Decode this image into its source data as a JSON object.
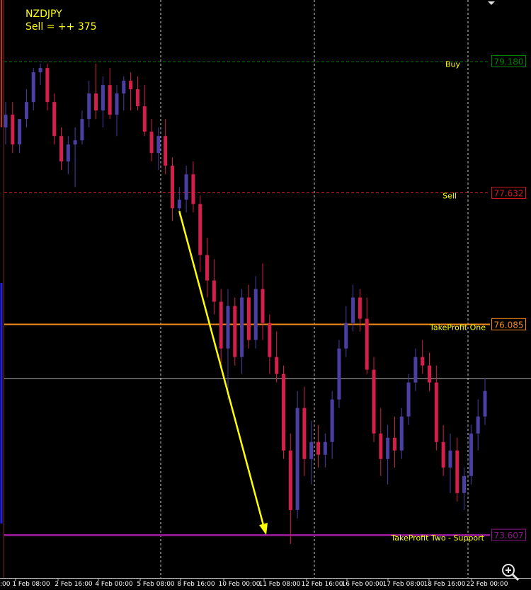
{
  "header": {
    "symbol": "NZDJPY",
    "signal": "Sell = ++ 375"
  },
  "colors": {
    "background": "#000000",
    "bull_candle": "#4c3fa3",
    "bear_candle": "#d41f4b",
    "grid": "#ffffff",
    "axis_label": "#ffffff",
    "buy_line": "#008000",
    "sell_line": "#cc1a1a",
    "tp1_line": "#f08a1c",
    "tp2_line": "#8a188a",
    "current_line": "#c8c8c8",
    "arrow": "#ffff00",
    "label_text": "#ffff00"
  },
  "chart_data": {
    "type": "candlestick",
    "symbol": "NZDJPY",
    "ylim": [
      73.1,
      79.9
    ],
    "x_axis_labels": [
      "1 Feb 08:00",
      "2 Feb 16:00",
      "4 Feb 00:00",
      "5 Feb 08:00",
      "8 Feb 16:00",
      "10 Feb 00:00",
      "11 Feb 08:00",
      "12 Feb 16:00",
      "16 Feb 00:00",
      "17 Feb 08:00",
      "18 Feb 16:00",
      "22 Feb 00:00"
    ],
    "x_axis_partial_label": ":00",
    "price_levels": [
      {
        "name": "Buy",
        "label": "Buy",
        "value": 79.18,
        "value_text": "79.180",
        "style": "dashed"
      },
      {
        "name": "Sell",
        "label": "Sell",
        "value": 77.632,
        "value_text": "77.632",
        "style": "dashed"
      },
      {
        "name": "TakeProfit One",
        "label": "TakeProfit One",
        "value": 76.085,
        "value_text": "76.085",
        "style": "solid"
      },
      {
        "name": "TakeProfit Two - Support",
        "label": "TakeProfit Two - Support",
        "value": 73.607,
        "value_text": "73.607",
        "style": "solid"
      }
    ],
    "current_price": 75.45,
    "candles": [
      [
        78.4,
        78.7,
        78.2,
        78.55
      ],
      [
        78.55,
        78.7,
        78.1,
        78.2
      ],
      [
        78.2,
        78.5,
        78.1,
        78.5
      ],
      [
        78.5,
        78.85,
        78.4,
        78.7
      ],
      [
        78.7,
        79.1,
        78.6,
        79.05
      ],
      [
        79.05,
        79.15,
        78.9,
        79.1
      ],
      [
        79.1,
        79.15,
        78.6,
        78.7
      ],
      [
        78.7,
        78.8,
        78.2,
        78.3
      ],
      [
        78.3,
        78.4,
        77.9,
        78.0
      ],
      [
        78.0,
        78.3,
        77.85,
        78.2
      ],
      [
        78.2,
        78.4,
        77.7,
        78.25
      ],
      [
        78.25,
        78.6,
        78.2,
        78.5
      ],
      [
        78.5,
        78.95,
        78.4,
        78.8
      ],
      [
        78.8,
        79.15,
        78.5,
        78.6
      ],
      [
        78.6,
        79.0,
        78.4,
        78.9
      ],
      [
        78.9,
        79.1,
        78.5,
        78.55
      ],
      [
        78.55,
        78.9,
        78.3,
        78.8
      ],
      [
        78.8,
        79.0,
        78.6,
        78.95
      ],
      [
        78.95,
        79.05,
        78.6,
        78.85
      ],
      [
        78.85,
        79.0,
        78.6,
        78.65
      ],
      [
        78.65,
        78.9,
        78.3,
        78.35
      ],
      [
        78.35,
        78.5,
        78.0,
        78.1
      ],
      [
        78.1,
        78.4,
        77.9,
        78.3
      ],
      [
        78.3,
        78.5,
        77.85,
        77.95
      ],
      [
        77.95,
        78.05,
        77.3,
        77.45
      ],
      [
        77.45,
        77.7,
        77.35,
        77.55
      ],
      [
        77.55,
        77.95,
        77.4,
        77.85
      ],
      [
        77.85,
        78.0,
        77.4,
        77.5
      ],
      [
        77.5,
        77.6,
        76.7,
        76.9
      ],
      [
        76.9,
        77.1,
        76.4,
        76.6
      ],
      [
        76.6,
        76.85,
        76.2,
        76.35
      ],
      [
        76.35,
        76.5,
        75.6,
        75.8
      ],
      [
        75.8,
        76.5,
        75.2,
        76.3
      ],
      [
        76.3,
        76.4,
        75.6,
        75.7
      ],
      [
        75.7,
        76.5,
        75.5,
        76.4
      ],
      [
        76.4,
        76.55,
        75.8,
        75.9
      ],
      [
        75.9,
        76.65,
        75.8,
        76.5
      ],
      [
        76.5,
        76.8,
        75.9,
        76.1
      ],
      [
        76.1,
        76.2,
        75.5,
        75.7
      ],
      [
        75.7,
        76.0,
        75.4,
        75.5
      ],
      [
        75.5,
        75.6,
        74.5,
        74.6
      ],
      [
        74.6,
        74.8,
        73.5,
        73.9
      ],
      [
        73.9,
        75.3,
        73.8,
        75.1
      ],
      [
        75.1,
        75.35,
        74.3,
        74.5
      ],
      [
        74.5,
        74.95,
        74.2,
        74.7
      ],
      [
        74.7,
        74.9,
        74.4,
        74.55
      ],
      [
        74.55,
        74.8,
        74.4,
        74.7
      ],
      [
        74.7,
        75.3,
        74.5,
        75.2
      ],
      [
        75.2,
        75.9,
        75.1,
        75.8
      ],
      [
        75.8,
        76.3,
        75.7,
        76.1
      ],
      [
        76.1,
        76.55,
        76.0,
        76.4
      ],
      [
        76.4,
        76.5,
        76.0,
        76.15
      ],
      [
        76.15,
        76.4,
        75.5,
        75.55
      ],
      [
        75.55,
        75.7,
        74.7,
        74.8
      ],
      [
        74.8,
        75.1,
        74.3,
        74.5
      ],
      [
        74.5,
        74.9,
        74.2,
        74.75
      ],
      [
        74.75,
        75.0,
        74.4,
        74.6
      ],
      [
        74.6,
        75.1,
        74.5,
        75.0
      ],
      [
        75.0,
        75.5,
        74.9,
        75.4
      ],
      [
        75.4,
        75.8,
        75.3,
        75.7
      ],
      [
        75.7,
        75.9,
        75.5,
        75.6
      ],
      [
        75.6,
        75.75,
        75.3,
        75.4
      ],
      [
        75.4,
        75.6,
        74.6,
        74.7
      ],
      [
        74.7,
        74.9,
        74.3,
        74.4
      ],
      [
        74.4,
        74.8,
        74.1,
        74.6
      ],
      [
        74.6,
        74.75,
        74.0,
        74.1
      ],
      [
        74.1,
        74.4,
        73.9,
        74.3
      ],
      [
        74.3,
        74.9,
        74.2,
        74.8
      ],
      [
        74.8,
        75.2,
        74.6,
        75.0
      ],
      [
        75.0,
        75.45,
        74.9,
        75.3
      ]
    ]
  }
}
